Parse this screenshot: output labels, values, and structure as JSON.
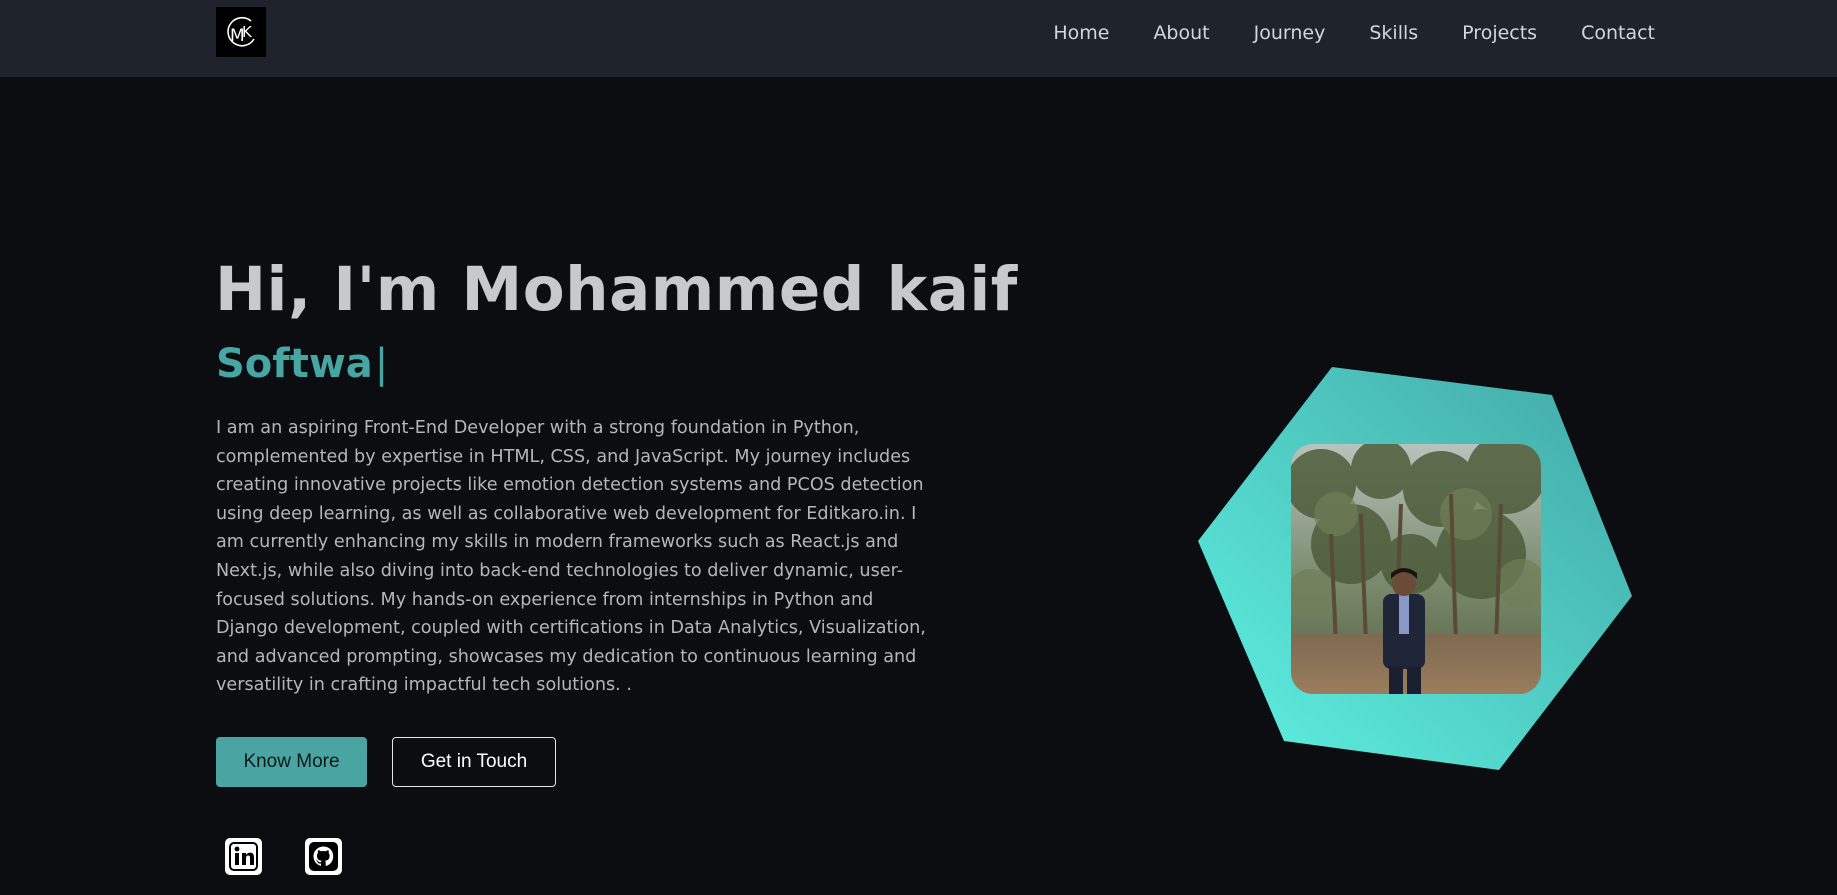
{
  "nav": {
    "logo_alt": "MK",
    "links": [
      "Home",
      "About",
      "Journey",
      "Skills",
      "Projects",
      "Contact"
    ]
  },
  "hero": {
    "title": "Hi, I'm Mohammed kaif",
    "subtitle": "Softwa",
    "cursor": "|",
    "bio": "I am an aspiring Front-End Developer with a strong foundation in Python, complemented by expertise in HTML, CSS, and JavaScript. My journey includes creating innovative projects like emotion detection systems and PCOS detection using deep learning, as well as collaborative web development for Editkaro.in. I am currently enhancing my skills in modern frameworks such as React.js and Next.js, while also diving into back-end technologies to deliver dynamic, user-focused solutions. My hands-on experience from internships in Python and Django development, coupled with certifications in Data Analytics, Visualization, and advanced prompting, showcases my dedication to continuous learning and versatility in crafting impactful tech solutions. .",
    "buttons": {
      "primary": "Know More",
      "secondary": "Get in Touch"
    }
  },
  "social": {
    "icons": [
      "linkedin-icon",
      "github-icon"
    ]
  },
  "colors": {
    "accent": "#46a6a4",
    "hex_gradient_start": "#5ef0e0",
    "hex_gradient_end": "#45aba8",
    "background": "#0b0d11",
    "navbar": "#1f232b"
  }
}
